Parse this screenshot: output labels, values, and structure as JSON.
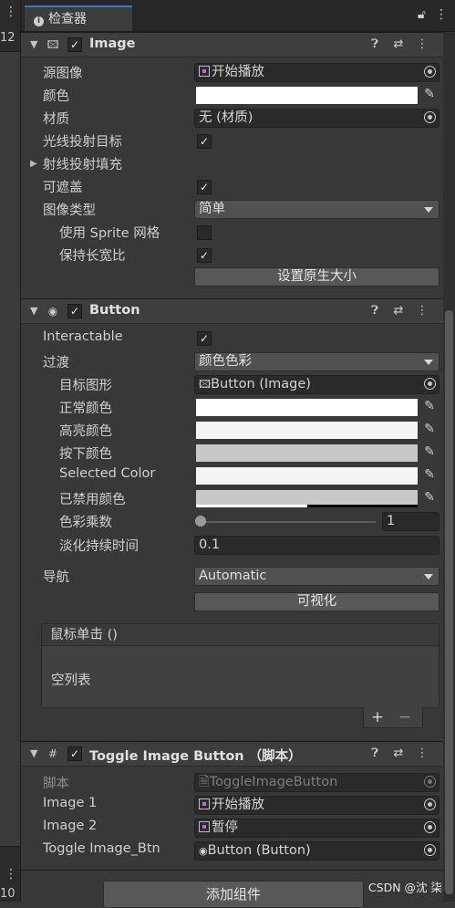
{
  "left_strip": {
    "number_top": "12",
    "number_bottom": "10"
  },
  "tab": {
    "label": "检查器"
  },
  "image_component": {
    "title": "Image",
    "fields": {
      "source_image_label": "源图像",
      "source_image_value": "开始播放",
      "color_label": "颜色",
      "material_label": "材质",
      "material_value": "无 (材质)",
      "raycast_target_label": "光线投射目标",
      "raycast_padding_label": "射线投射填充",
      "maskable_label": "可遮盖",
      "image_type_label": "图像类型",
      "image_type_value": "简单",
      "use_sprite_mesh_label": "使用 Sprite 网格",
      "preserve_aspect_label": "保持长宽比",
      "set_native_size_button": "设置原生大小"
    }
  },
  "button_component": {
    "title": "Button",
    "fields": {
      "interactable_label": "Interactable",
      "transition_label": "过渡",
      "transition_value": "颜色色彩",
      "target_graphic_label": "目标图形",
      "target_graphic_value": "Button (Image)",
      "normal_color_label": "正常颜色",
      "highlighted_color_label": "高亮颜色",
      "pressed_color_label": "按下颜色",
      "selected_color_label": "Selected Color",
      "disabled_color_label": "已禁用颜色",
      "color_multiplier_label": "色彩乘数",
      "color_multiplier_value": "1",
      "fade_duration_label": "淡化持续时间",
      "fade_duration_value": "0.1",
      "navigation_label": "导航",
      "navigation_value": "Automatic",
      "visualize_button": "可视化",
      "on_click_header": "鼠标单击 ()",
      "on_click_empty": "空列表"
    }
  },
  "toggle_component": {
    "title": "Toggle Image Button （脚本）",
    "fields": {
      "script_label": "脚本",
      "script_value": "ToggleImageButton",
      "image1_label": "Image 1",
      "image1_value": "开始播放",
      "image2_label": "Image 2",
      "image2_value": "暂停",
      "toggle_btn_label": "Toggle Image_Btn",
      "toggle_btn_value": "Button (Button)"
    }
  },
  "add_component_button": "添加组件",
  "watermark": "CSDN @沈 柒"
}
